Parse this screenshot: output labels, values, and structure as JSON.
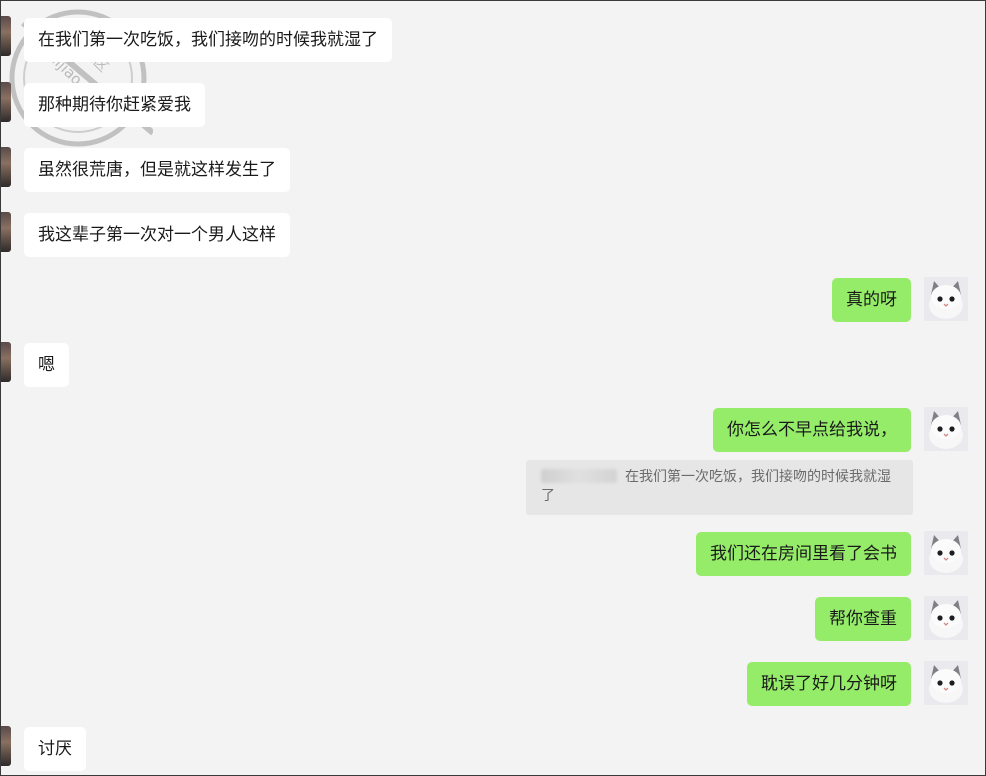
{
  "messages": [
    {
      "side": "left",
      "text": "在我们第一次吃饭，我们接吻的时候我就湿了"
    },
    {
      "side": "left",
      "text": "那种期待你赶紧爱我"
    },
    {
      "side": "left",
      "text": "虽然很荒唐，但是就这样发生了"
    },
    {
      "side": "left",
      "text": "我这辈子第一次对一个男人这样"
    },
    {
      "side": "right",
      "text": "真的呀"
    },
    {
      "side": "left",
      "text": "嗯"
    },
    {
      "side": "right",
      "text": "你怎么不早点给我说，"
    },
    {
      "side": "right",
      "text": "我们还在房间里看了会书"
    },
    {
      "side": "right",
      "text": "帮你查重"
    },
    {
      "side": "right",
      "text": "耽误了好几分钟呀"
    },
    {
      "side": "left",
      "text": "讨厌"
    }
  ],
  "quote": {
    "text": "在我们第一次吃饭，我们接吻的时候我就湿了"
  },
  "watermark": {
    "text": "海角社区 haijiao.com"
  },
  "colors": {
    "background": "#f3f3f3",
    "incoming_bubble": "#ffffff",
    "outgoing_bubble": "#95ec69",
    "quote_bg": "#e6e6e6"
  }
}
